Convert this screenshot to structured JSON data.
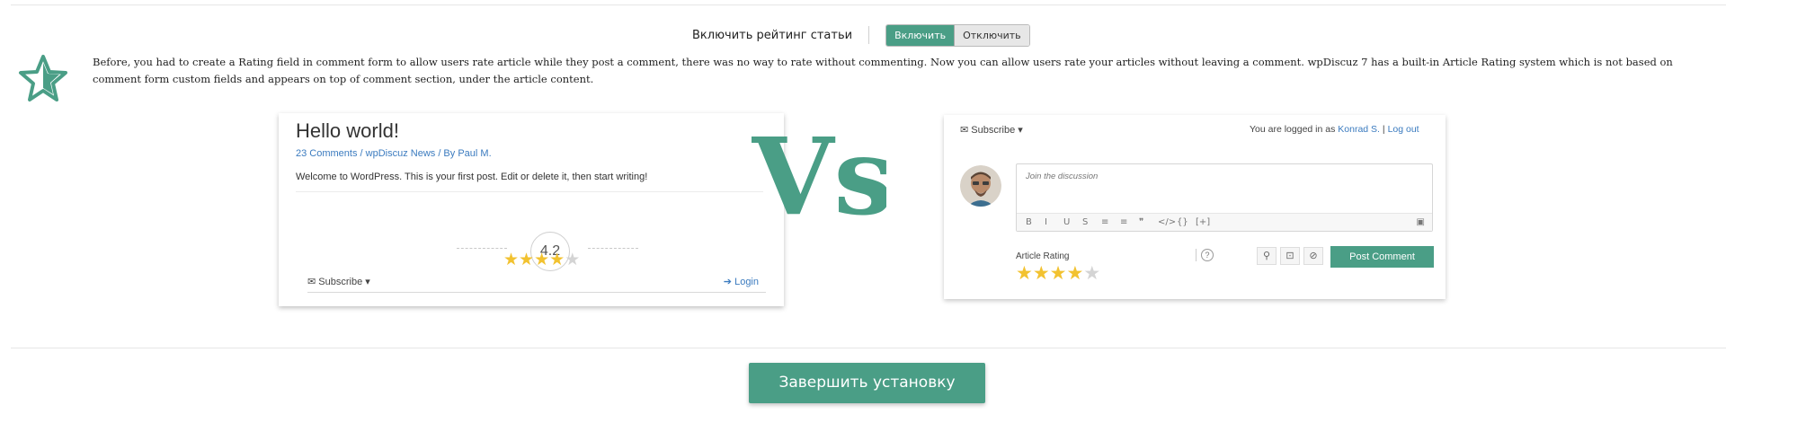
{
  "toggle": {
    "label": "Включить рейтинг статьи",
    "on_label": "Включить",
    "off_label": "Отключить"
  },
  "description": "Before, you had to create a Rating field in comment form to allow users rate article while they post a comment, there was no way to rate without commenting. Now you can allow users rate your articles without leaving a comment. wpDiscuz 7 has a built-in Article Rating system which is not based on comment form custom fields and appears on top of comment section, under the article content.",
  "preview_left": {
    "title": "Hello world!",
    "meta": "23 Comments / wpDiscuz News / By Paul M.",
    "body": "Welcome to WordPress. This is your first post. Edit or delete it, then start writing!",
    "rating_value": "4.2",
    "stars_filled": 4,
    "stars_total": 5,
    "subscribe": "Subscribe",
    "login": "Login"
  },
  "vs_text": "Vs",
  "preview_right": {
    "subscribe": "Subscribe",
    "logged_prefix": "You are logged in as",
    "user": "Konrad S.",
    "logout": "Log out",
    "placeholder": "Join the discussion",
    "article_rating_label": "Article Rating",
    "stars_filled": 4,
    "stars_total": 5,
    "post_comment": "Post Comment",
    "toolbar": [
      "B",
      "I",
      "U",
      "S",
      "≡",
      "≡",
      "❞",
      "</>",
      "{}",
      "[+]"
    ]
  },
  "finish_button": "Завершить установку",
  "colors": {
    "accent": "#4a9e86",
    "link": "#3b7bbf",
    "star": "#f2c230"
  }
}
